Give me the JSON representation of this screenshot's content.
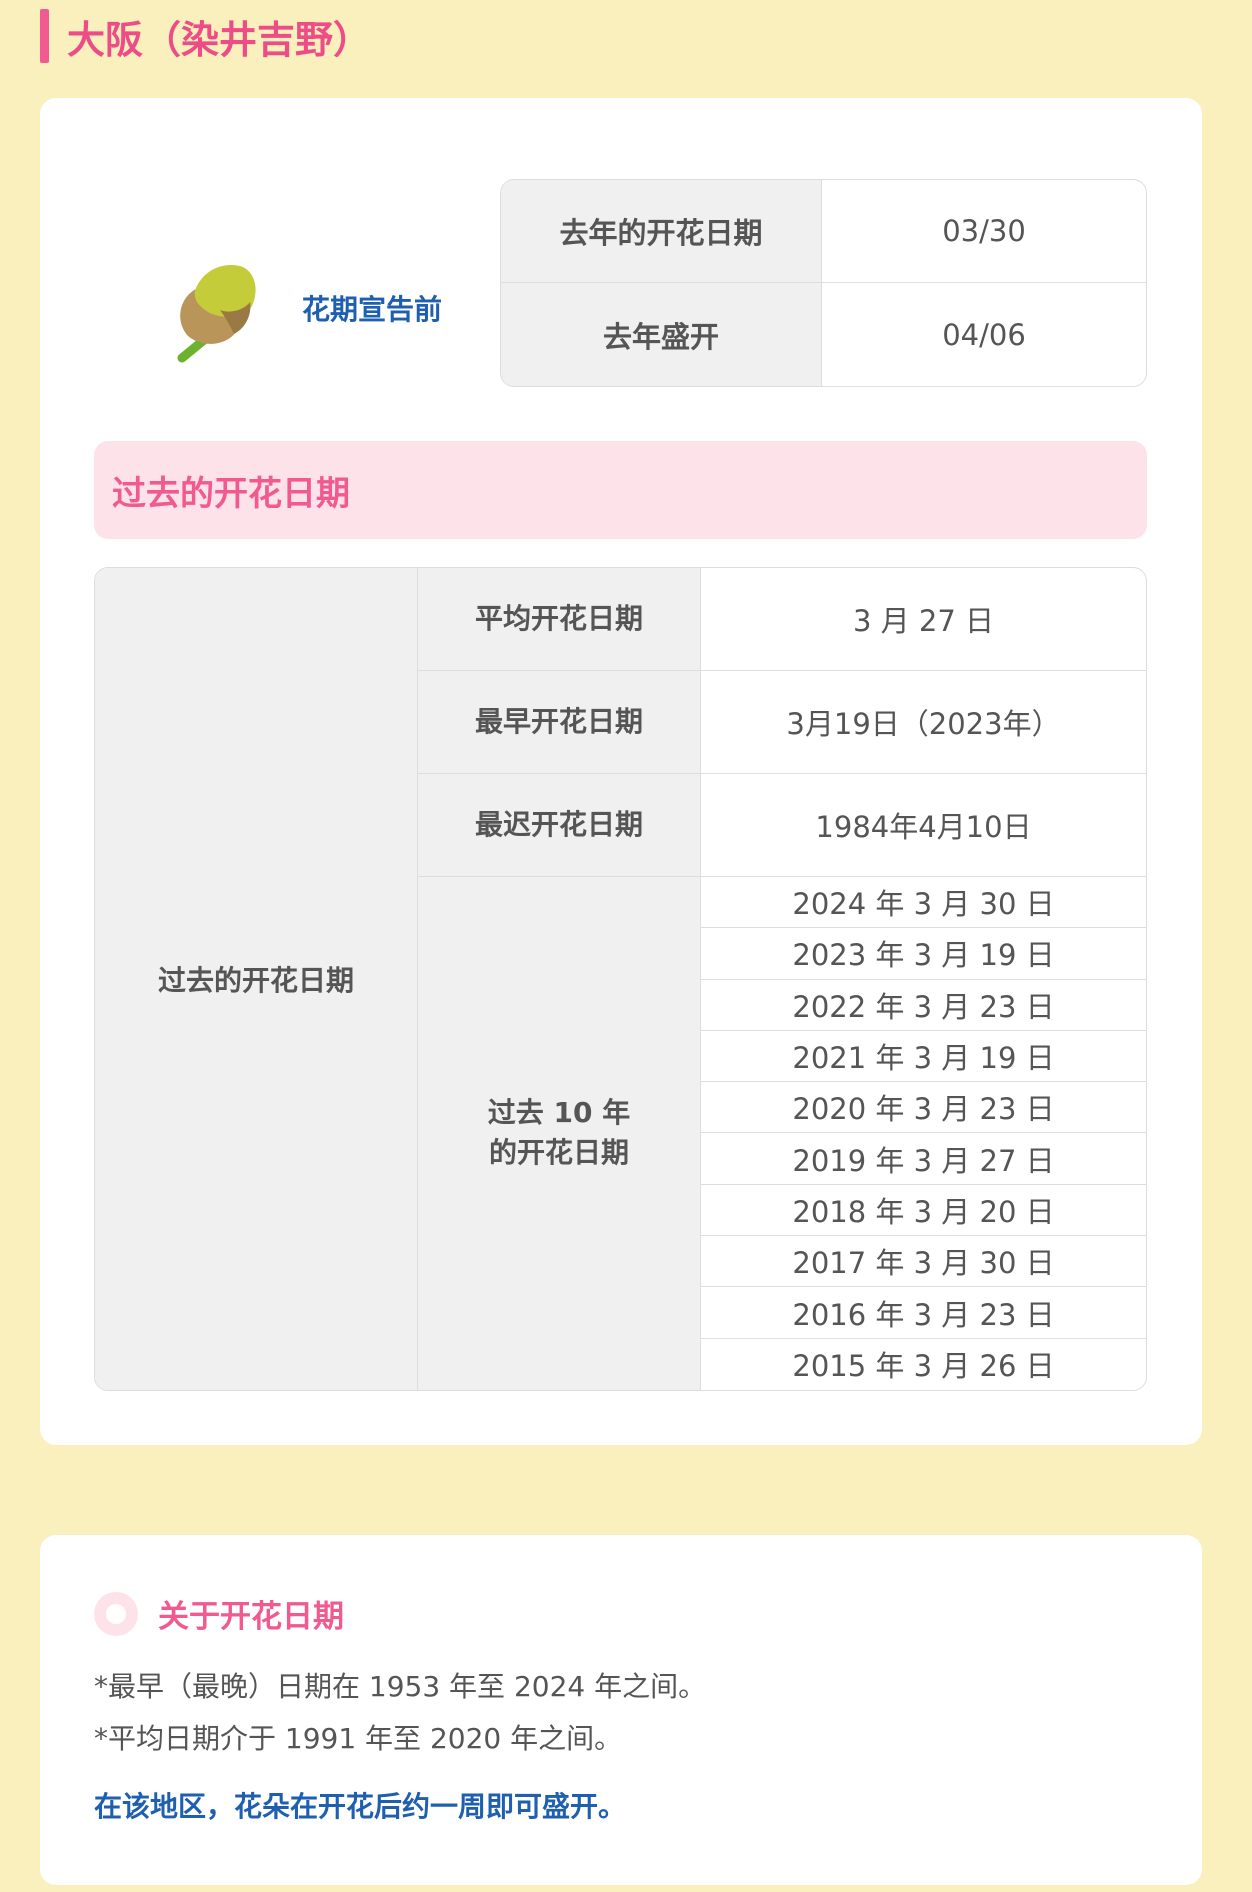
{
  "header": {
    "title": "大阪（染井吉野）"
  },
  "status": {
    "label": "花期宣告前",
    "icon": "bud-icon"
  },
  "last_year": {
    "rows": [
      {
        "label": "去年的开花日期",
        "value": "03/30"
      },
      {
        "label": "去年盛开",
        "value": "04/06"
      }
    ]
  },
  "past": {
    "heading": "过去的开花日期",
    "group_label": "过去的开花日期",
    "average": {
      "label": "平均开花日期",
      "value": "3 月 27 日"
    },
    "earliest": {
      "label": "最早开花日期",
      "value": "3月19日（2023年）"
    },
    "latest": {
      "label": "最迟开花日期",
      "value": "1984年4月10日"
    },
    "ten_years_label": "过去 10 年的开花日期",
    "years": [
      "2024 年 3 月 30 日",
      "2023 年 3 月 19 日",
      "2022 年 3 月 23 日",
      "2021 年 3 月 19 日",
      "2020 年 3 月 23 日",
      "2019 年 3 月 27 日",
      "2018 年 3 月 20 日",
      "2017 年 3 月 30 日",
      "2016 年 3 月 23 日",
      "2015 年 3 月 26 日"
    ]
  },
  "note": {
    "title": "关于开花日期",
    "line1": "*最早（最晚）日期在 1953 年至 2024 年之间。",
    "line2": "*平均日期介于 1991 年至 2020 年之间。",
    "emphasis": "在该地区，花朵在开花后约一周即可盛开。"
  },
  "colors": {
    "accent": "#f05a8f",
    "link": "#1f5fb0",
    "background": "#f9f0bd"
  }
}
